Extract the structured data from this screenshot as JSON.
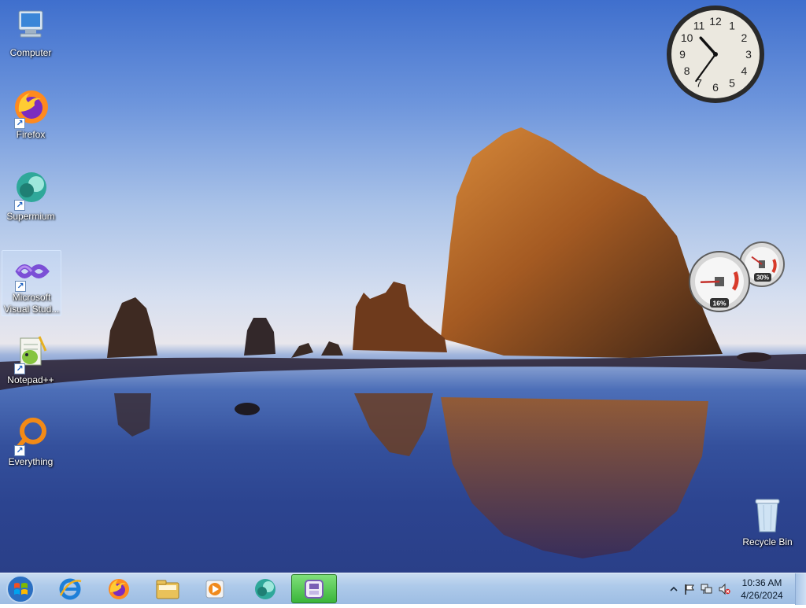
{
  "desktop": {
    "icons": [
      {
        "label": "Computer"
      },
      {
        "label": "Firefox"
      },
      {
        "label": "Supermium"
      },
      {
        "label": "Microsoft Visual Stud..."
      },
      {
        "label": "Notepad++"
      },
      {
        "label": "Everything"
      },
      {
        "label": "Recycle Bin"
      }
    ]
  },
  "gadgets": {
    "clock": {
      "numerals": [
        "12",
        "1",
        "2",
        "3",
        "4",
        "5",
        "6",
        "7",
        "8",
        "9",
        "10",
        "11"
      ],
      "hour": 10,
      "minute": 36
    },
    "cpu_meter": {
      "cpu_label": "16%",
      "memory_label": "30%",
      "cpu_value": 16,
      "memory_value": 30
    }
  },
  "taskbar": {
    "pinned": [
      {
        "icon": "internet-explorer-icon"
      },
      {
        "icon": "firefox-icon"
      },
      {
        "icon": "file-explorer-icon"
      },
      {
        "icon": "media-player-icon"
      },
      {
        "icon": "supermium-icon"
      },
      {
        "icon": "app-window-icon",
        "active": true
      }
    ],
    "tray": {
      "time": "10:36 AM",
      "date": "4/26/2024"
    }
  },
  "colors": {
    "taskbar": "#aecaea",
    "active_button": "#39b53a"
  }
}
